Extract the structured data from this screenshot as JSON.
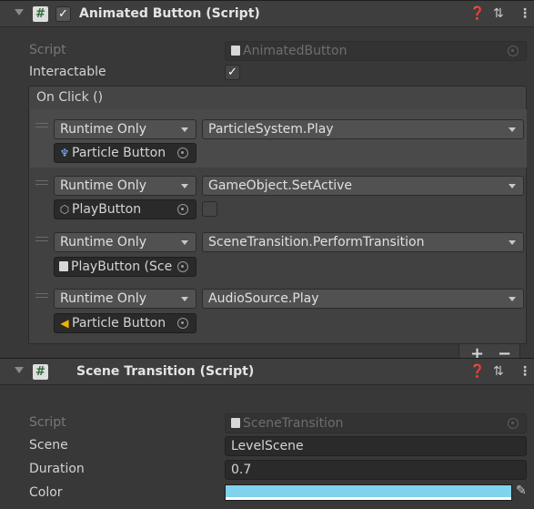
{
  "animated_button": {
    "title": "Animated Button (Script)",
    "enabled": true,
    "script_label": "Script",
    "script_value": "AnimatedButton",
    "interactable_label": "Interactable",
    "interactable_checked": true,
    "on_click_label": "On Click ()",
    "entries": [
      {
        "mode": "Runtime Only",
        "function": "ParticleSystem.Play",
        "object_icon": "particle-system-icon",
        "object": "Particle Button"
      },
      {
        "mode": "Runtime Only",
        "function": "GameObject.SetActive",
        "object_icon": "gameobject-cube-icon",
        "object": "PlayButton",
        "arg_checked": false
      },
      {
        "mode": "Runtime Only",
        "function": "SceneTransition.PerformTransition",
        "object_icon": "script-icon",
        "object": "PlayButton (Sce"
      },
      {
        "mode": "Runtime Only",
        "function": "AudioSource.Play",
        "object_icon": "audio-source-icon",
        "object": "Particle Button"
      }
    ],
    "add_label": "+",
    "remove_label": "−"
  },
  "scene_transition": {
    "title": "Scene Transition (Script)",
    "script_label": "Script",
    "script_value": "SceneTransition",
    "scene_label": "Scene",
    "scene_value": "LevelScene",
    "duration_label": "Duration",
    "duration_value": "0.7",
    "color_label": "Color",
    "color_value": "#7fd3ec"
  },
  "header_icons": {
    "help": "?",
    "presets": "⇅",
    "menu": "⋮"
  }
}
